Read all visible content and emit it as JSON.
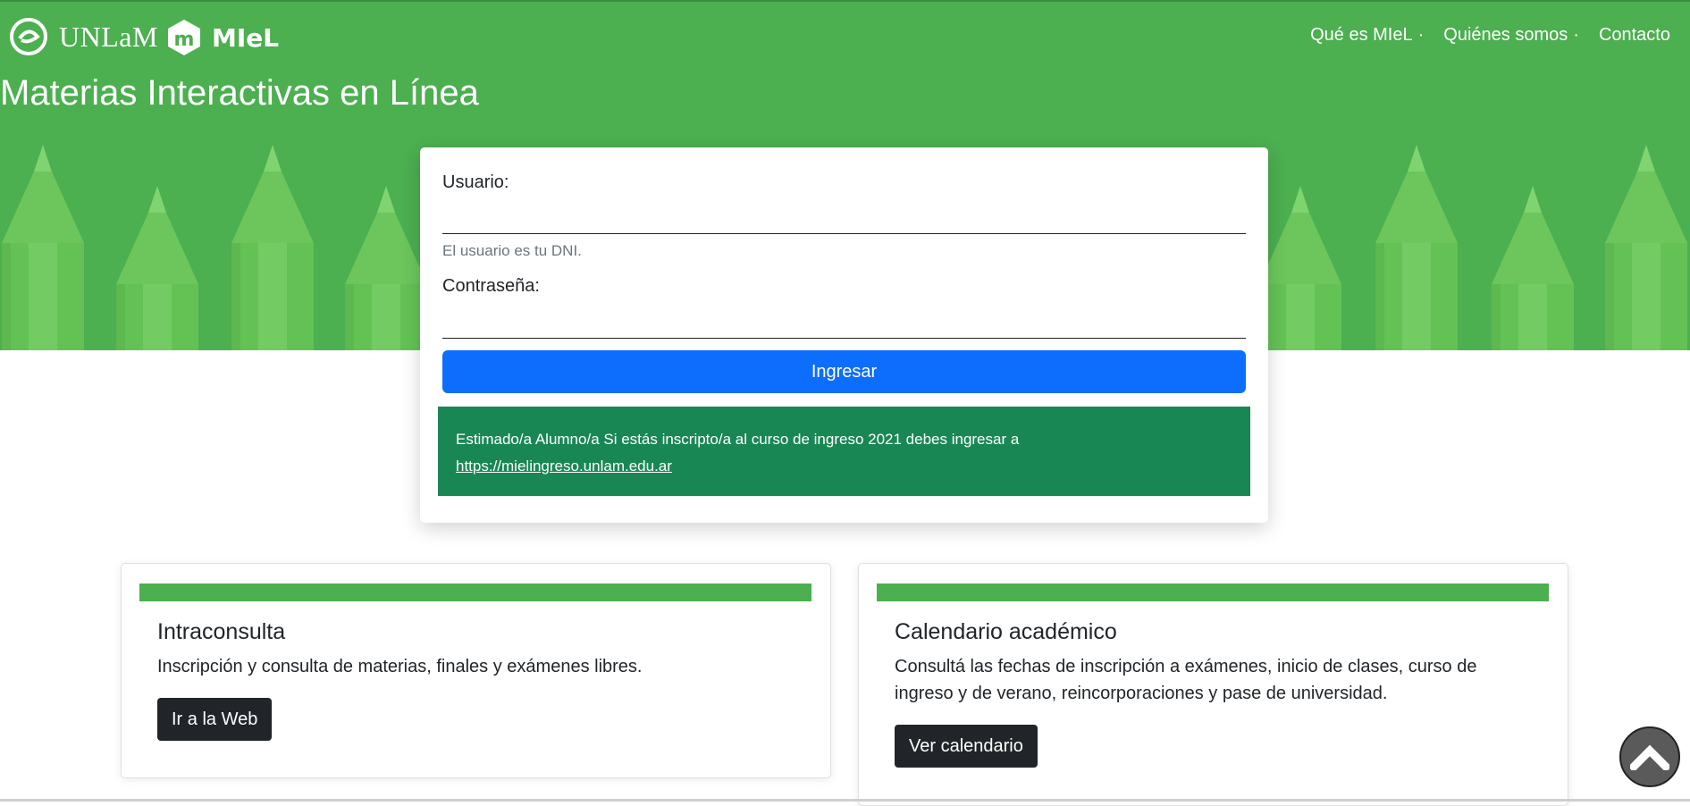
{
  "header": {
    "unlam_logo_text": "UNLaM",
    "miel_logo_text": "MIeL",
    "nav": [
      {
        "label": "Qué es MIeL"
      },
      {
        "label": "Quiénes somos"
      },
      {
        "label": "Contacto"
      }
    ],
    "nav_separator": "·",
    "title": "Materias Interactivas en Línea"
  },
  "login": {
    "user_label": "Usuario:",
    "user_value": "",
    "user_help": "El usuario es tu DNI.",
    "password_label": "Contraseña:",
    "password_value": "",
    "submit_label": "Ingresar",
    "notice_text": "Estimado/a Alumno/a Si estás inscripto/a al curso de ingreso 2021 debes ingresar a",
    "notice_link": "https://mielingreso.unlam.edu.ar"
  },
  "cards": [
    {
      "title": "Intraconsulta",
      "description": "Inscripción y consulta de materias, finales y exámenes libres.",
      "button_label": "Ir a la Web"
    },
    {
      "title": "Calendario académico",
      "description": "Consultá las fechas de inscripción a exámenes, inicio de clases, curso de ingreso y de verano, reincorporaciones y pase de universidad.",
      "button_label": "Ver calendario"
    }
  ],
  "icons": {
    "unlam_logo": "unlam-logo-icon",
    "miel_logo": "miel-logo-icon",
    "scroll_top": "chevron-up-icon"
  },
  "colors": {
    "hero_green": "#4caf50",
    "pencil_green": "#6cc65c",
    "primary_button": "#0d6efd",
    "notice_green": "#198754",
    "dark_button": "#212529"
  }
}
